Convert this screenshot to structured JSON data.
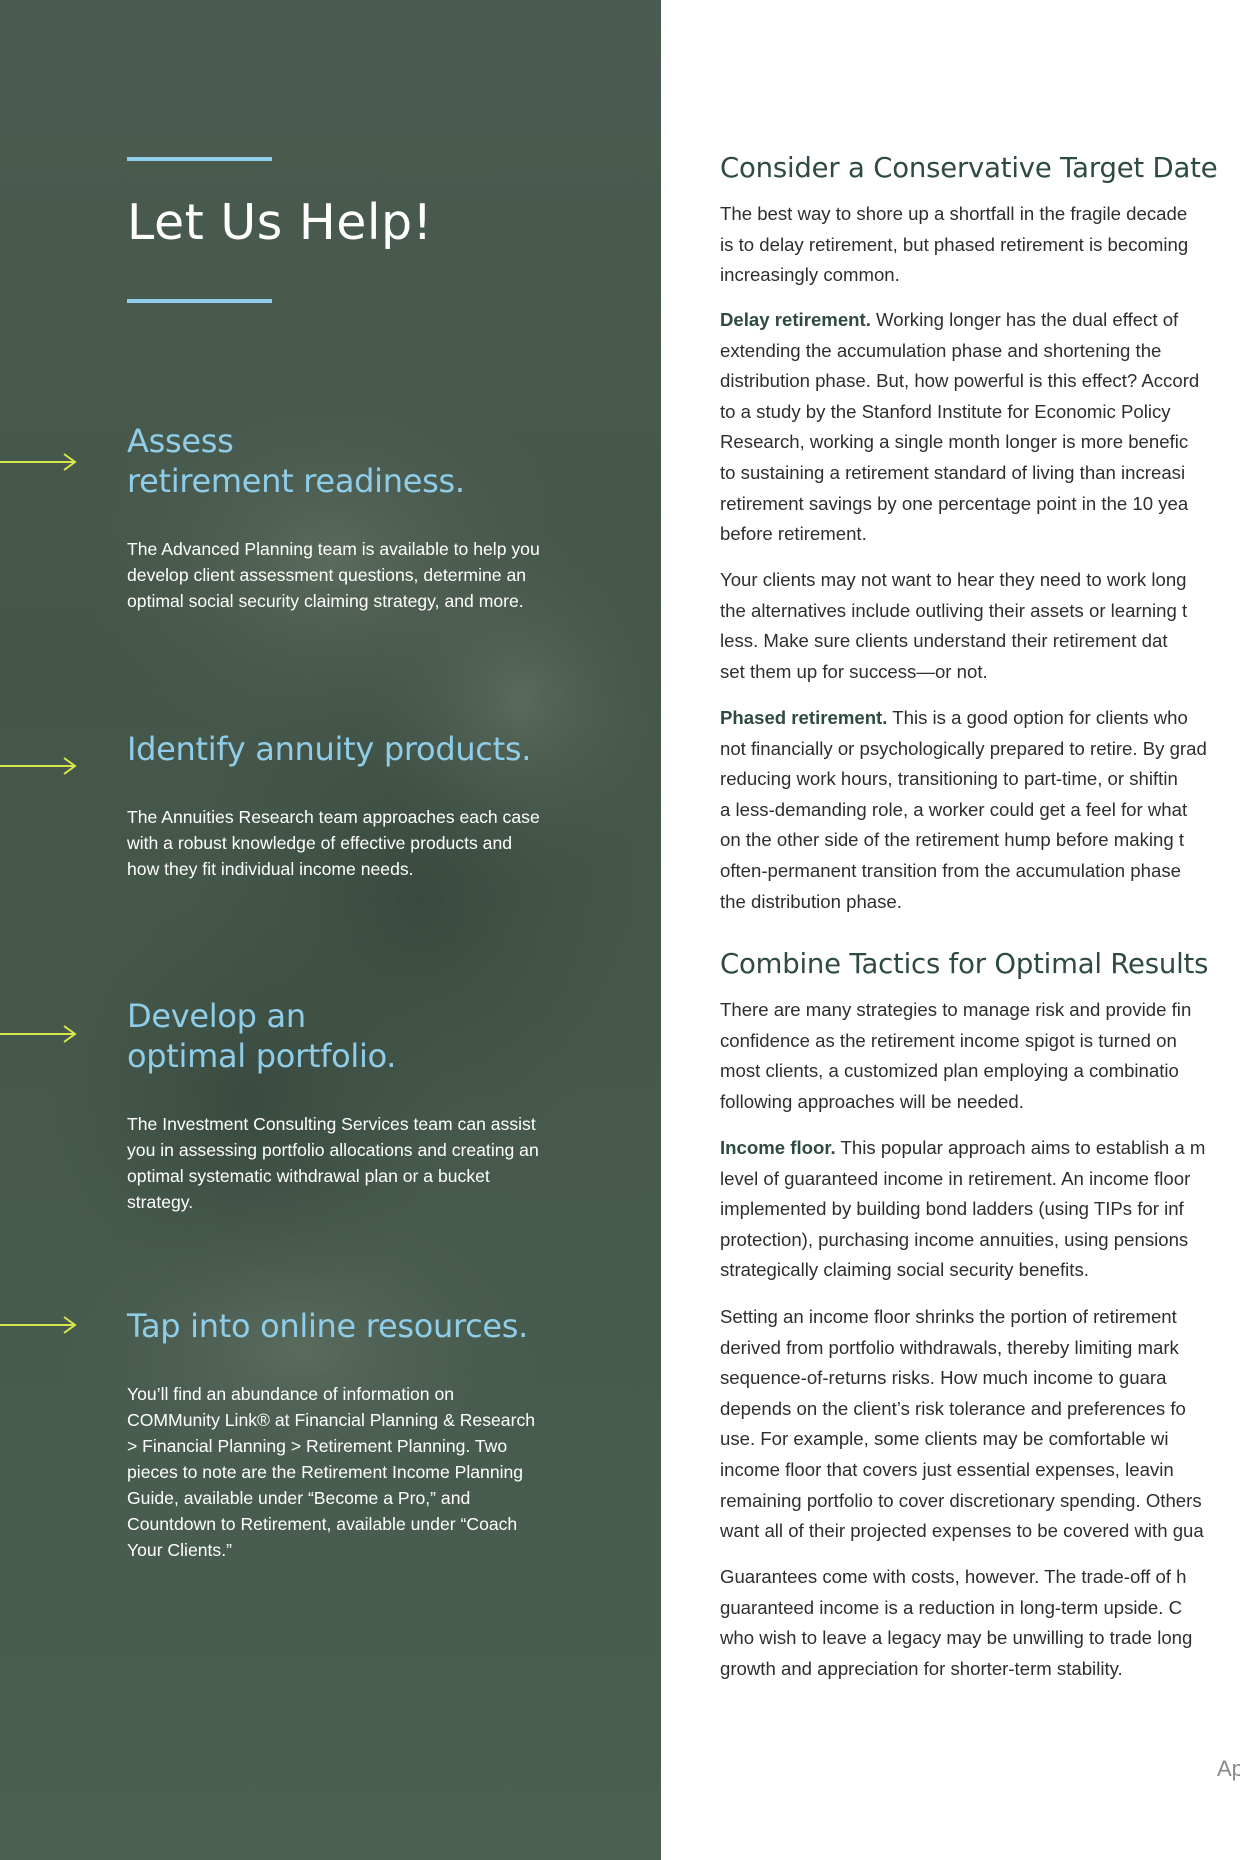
{
  "panel": {
    "title": "Let Us Help!",
    "accent_color": "#8fcde8",
    "arrow_color": "#d6e84a",
    "services": [
      {
        "heading_lines": [
          "Assess",
          "retirement readiness."
        ],
        "body": "The Advanced Planning team is available to help you develop client assessment questions, determine an optimal social security claiming strategy, and more."
      },
      {
        "heading_lines": [
          "Identify annuity products."
        ],
        "body": "The Annuities Research team approaches each case with a robust knowledge of effective products and how they fit individual income needs."
      },
      {
        "heading_lines": [
          "Develop an",
          "optimal portfolio."
        ],
        "body": "The Investment Consulting Services team can assist you in assessing portfolio allocations and creating an optimal systematic withdrawal plan or a bucket strategy."
      },
      {
        "heading_lines": [
          "Tap into online resources."
        ],
        "body": "You’ll find an abundance of information on COMMunity Link® at Financial Planning & Research > Financial Planning > Retirement Planning. Two pieces to note are the Retirement Income Planning Guide, available under “Become a Pro,” and Countdown to Retirement, available under “Coach Your Clients.”"
      }
    ]
  },
  "article": {
    "sections": [
      {
        "heading": "Consider a Conservative Target Date",
        "paragraphs": [
          {
            "lead": "",
            "lines": [
              "The best way to shore up a shortfall in the fragile decade",
              "is to delay retirement, but phased retirement is becoming",
              "increasingly common."
            ]
          },
          {
            "lead": "Delay retirement.",
            "lines": [
              " Working longer has the dual effect of",
              "extending the accumulation phase and shortening the",
              "distribution phase. But, how powerful is this effect? Accord",
              "to a study by the Stanford Institute for Economic Policy",
              "Research, working a single month longer is more benefic",
              "to sustaining a retirement standard of living than increasi",
              "retirement savings by one percentage point in the 10 yea",
              "before retirement."
            ]
          },
          {
            "lead": "",
            "lines": [
              "Your clients may not want to hear they need to work long",
              "the alternatives include outliving their assets or learning t",
              "less. Make sure clients understand their retirement dat",
              "set them up for success—or not."
            ]
          },
          {
            "lead": "Phased retirement.",
            "lines": [
              " This is a good option for clients who",
              "not financially or psychologically prepared to retire. By grad",
              "reducing work hours, transitioning to part-time, or shiftin",
              "a less-demanding role, a worker could get a feel for what",
              "on the other side of the retirement hump before making t",
              "often-permanent transition from the accumulation phase",
              "the distribution phase."
            ]
          }
        ]
      },
      {
        "heading": "Combine Tactics for Optimal Results",
        "paragraphs": [
          {
            "lead": "",
            "lines": [
              "There are many strategies to manage risk and provide fin",
              "confidence as the retirement income spigot is turned on",
              "most clients, a customized plan employing a combinatio",
              "following approaches will be needed."
            ]
          },
          {
            "lead": "Income floor.",
            "lines": [
              " This popular approach aims to establish a m",
              "level of guaranteed income in retirement. An income floor",
              "implemented by building bond ladders (using TIPs for inf",
              "protection), purchasing income annuities, using pensions",
              "strategically claiming social security benefits."
            ]
          },
          {
            "lead": "",
            "lines": [
              "Setting an income floor shrinks the portion of retirement",
              "derived from portfolio withdrawals, thereby limiting mark",
              "sequence-of-returns risks. How much income to guara",
              "depends on the client’s risk tolerance and preferences fo",
              "use. For example, some clients may be comfortable wi",
              "income floor that covers just essential expenses, leavin",
              "remaining portfolio to cover discretionary spending. Others",
              "want all of their projected expenses to be covered with gua"
            ]
          },
          {
            "lead": "",
            "lines": [
              "Guarantees come with costs, however. The trade-off of h",
              "guaranteed income is a reduction in long-term upside. C",
              "who wish to leave a legacy may be unwilling to trade long",
              "growth and appreciation for shorter-term stability."
            ]
          }
        ]
      }
    ],
    "footer": "Ap"
  }
}
